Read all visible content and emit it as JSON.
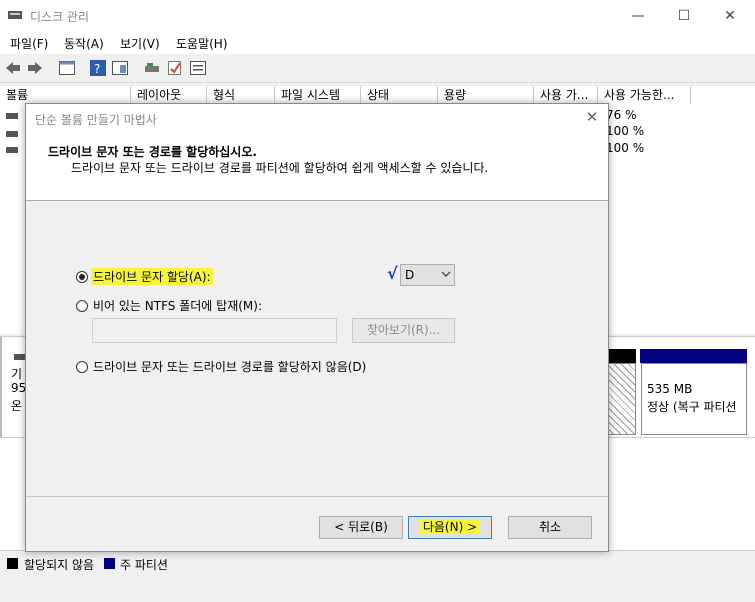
{
  "window": {
    "title": "디스크 관리",
    "minimize": "—",
    "maximize": "☐",
    "close": "✕"
  },
  "menu": [
    "파일(F)",
    "동작(A)",
    "보기(V)",
    "도움말(H)"
  ],
  "grid": {
    "headers": [
      "볼륨",
      "레이아웃",
      "형식",
      "파일 시스템",
      "상태",
      "용량",
      "사용 가...",
      "사용 가능한..."
    ],
    "percent_values": [
      "76 %",
      "100 %",
      "100 %"
    ]
  },
  "lower": {
    "disk_label_lines": [
      "기",
      "95",
      "온"
    ],
    "partition_size": "535 MB",
    "partition_status": "정상 (복구 파티션"
  },
  "legend": {
    "unallocated": "할당되지 않음",
    "primary": "주 파티션"
  },
  "dialog": {
    "title": "단순 볼륨 만들기 마법사",
    "heading": "드라이브 문자 또는 경로를 할당하십시오.",
    "subheading": "드라이브 문자 또는 드라이브 경로를 파티션에 할당하여 쉽게 액세스할 수 있습니다.",
    "option_assign_letter": "드라이브 문자 할당(A):",
    "drive_letter": "D",
    "check_mark": "√",
    "option_mount_ntfs": "비어 있는 NTFS 폴더에 탑재(M):",
    "mount_path": "",
    "browse_button": "찾아보기(R)...",
    "option_no_letter": "드라이브 문자 또는 드라이브 경로를 할당하지 않음(D)",
    "back_button": "< 뒤로(B)",
    "next_button": "다음(N) >",
    "cancel_button": "취소"
  },
  "colors": {
    "highlight": "#f6f53a",
    "primary_partition": "#000080",
    "unallocated": "#000000"
  }
}
